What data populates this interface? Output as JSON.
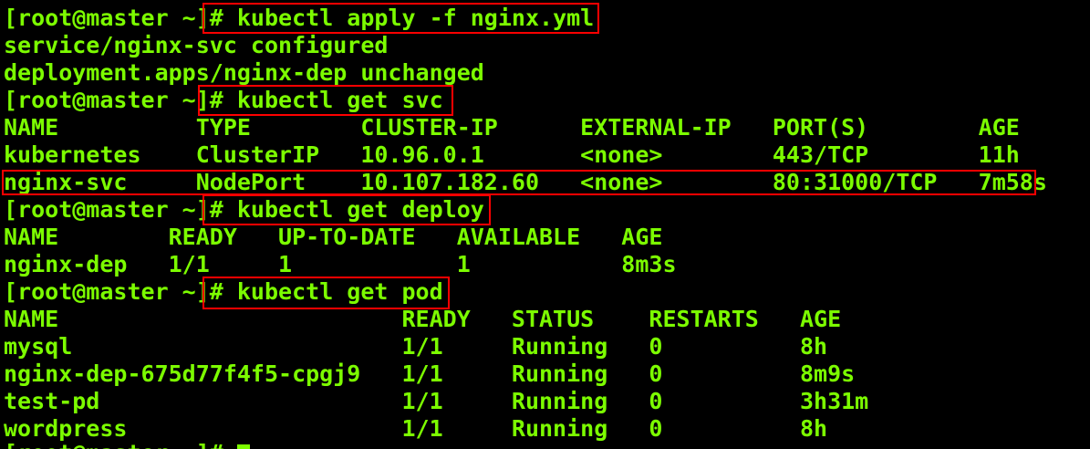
{
  "terminal": {
    "colors": {
      "background": "#000000",
      "text": "#7CFC00",
      "highlight_box": "#ff0000"
    },
    "lines": [
      {
        "prompt": "[root@master ~]",
        "command": "# kubectl apply -f nginx.yml"
      },
      {
        "text": "service/nginx-svc configured"
      },
      {
        "text": "deployment.apps/nginx-dep unchanged"
      },
      {
        "prompt": "[root@master ~]",
        "command": "# kubectl get svc"
      },
      {
        "text": "NAME          TYPE        CLUSTER-IP      EXTERNAL-IP   PORT(S)        AGE"
      },
      {
        "text": "kubernetes    ClusterIP   10.96.0.1       <none>        443/TCP        11h"
      },
      {
        "text": "nginx-svc     NodePort    10.107.182.60   <none>        80:31000/TCP   7m58s"
      },
      {
        "prompt": "[root@master ~]",
        "command": "# kubectl get deploy"
      },
      {
        "text": "NAME        READY   UP-TO-DATE   AVAILABLE   AGE"
      },
      {
        "text": "nginx-dep   1/1     1            1           8m3s"
      },
      {
        "prompt": "[root@master ~]",
        "command": "# kubectl get pod"
      },
      {
        "text": "NAME                         READY   STATUS    RESTARTS   AGE"
      },
      {
        "text": "mysql                        1/1     Running   0          8h"
      },
      {
        "text": "nginx-dep-675d77f4f5-cpgj9   1/1     Running   0          8m9s"
      },
      {
        "text": "test-pd                      1/1     Running   0          3h31m"
      },
      {
        "text": "wordpress                    1/1     Running   0          8h"
      }
    ],
    "final_prompt": "[root@master ~]# "
  }
}
